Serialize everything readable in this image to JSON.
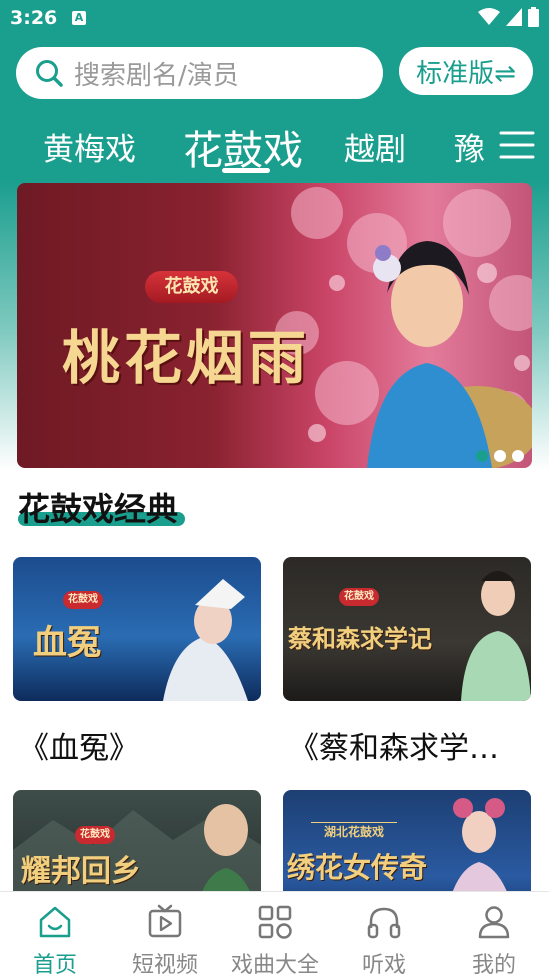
{
  "status_bar": {
    "time": "3:26",
    "notif": "A"
  },
  "search": {
    "placeholder": "搜索剧名/演员",
    "version_label": "标准版⇌"
  },
  "tabs": [
    {
      "label": "黄梅戏"
    },
    {
      "label": "花鼓戏"
    },
    {
      "label": "越剧"
    },
    {
      "label": "豫"
    }
  ],
  "banner": {
    "badge": "花鼓戏",
    "title": "桃花烟雨",
    "slide_count": 3,
    "active_slide": 1
  },
  "section": {
    "title": "花鼓戏经典"
  },
  "cards": [
    {
      "badge": "花鼓戏",
      "art_title": "血冤",
      "title": "《血冤》"
    },
    {
      "badge": "花鼓戏",
      "art_title": "蔡和森求学记",
      "title": "《蔡和森求学记..."
    },
    {
      "badge": "花鼓戏",
      "art_title": "耀邦回乡",
      "title": ""
    },
    {
      "badge": "湖北花鼓戏",
      "art_title": "绣花女传奇",
      "title": ""
    }
  ],
  "bottom_nav": [
    {
      "label": "首页",
      "icon": "home-icon"
    },
    {
      "label": "短视频",
      "icon": "video-icon"
    },
    {
      "label": "戏曲大全",
      "icon": "grid-icon"
    },
    {
      "label": "听戏",
      "icon": "headphones-icon"
    },
    {
      "label": "我的",
      "icon": "profile-icon"
    }
  ],
  "colors": {
    "accent": "#1a9e8e",
    "banner_gold": "#f6d791"
  }
}
